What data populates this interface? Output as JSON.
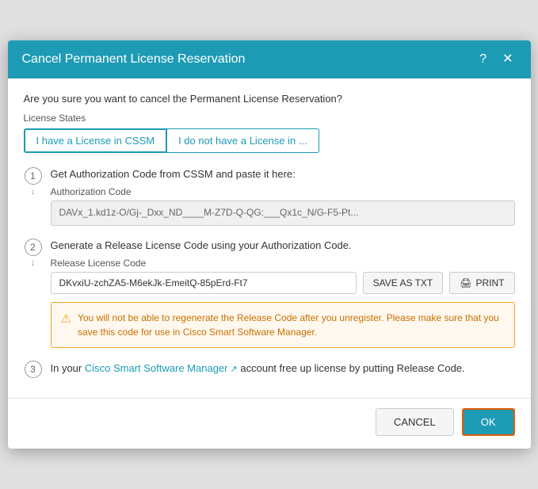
{
  "dialog": {
    "title": "Cancel Permanent License Reservation",
    "help_icon": "?",
    "close_icon": "✕"
  },
  "body": {
    "confirm_text": "Are you sure you want to cancel the Permanent License Reservation?",
    "license_states_label": "License States",
    "tabs": [
      {
        "label": "I have a License in CSSM",
        "active": true
      },
      {
        "label": "I do not have a License in ...",
        "active": false
      }
    ],
    "steps": [
      {
        "number": "1",
        "description": "Get Authorization Code from CSSM and paste it here:",
        "field_label": "Authorization Code",
        "field_value": "DAVx_1.kd1z-O/Gj-_Dxx_ND____M-Z7D-Q-QG:___Qx1c_N/G-F5-Pt..."
      },
      {
        "number": "2",
        "description": "Generate a Release License Code using your Authorization Code.",
        "field_label": "Release License Code",
        "field_value": "DKvxiU-zchZA5-M6ekJk-EmeitQ-85pErd-Ft7",
        "save_btn": "SAVE AS TXT",
        "print_btn": "PRINT",
        "warning": "You will not be able to regenerate the Release Code after you unregister. Please make sure that you save this code for use in Cisco Smart Software Manager."
      },
      {
        "number": "3",
        "description_before": "In your ",
        "description_link": "Cisco Smart Software Manager",
        "description_after": " account free up license by putting Release Code."
      }
    ]
  },
  "footer": {
    "cancel_label": "CANCEL",
    "ok_label": "OK"
  },
  "icons": {
    "print": "🖨",
    "warning": "⚠"
  }
}
